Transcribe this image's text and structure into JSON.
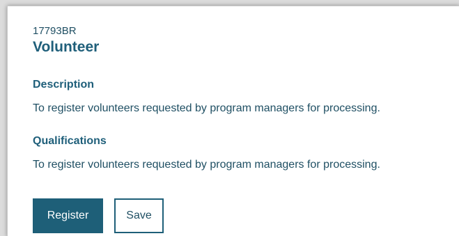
{
  "job": {
    "id": "17793BR",
    "title": "Volunteer"
  },
  "sections": {
    "description": {
      "heading": "Description",
      "text": "To register volunteers requested by program managers for processing."
    },
    "qualifications": {
      "heading": "Qualifications",
      "text": "To register volunteers requested by program managers for processing."
    }
  },
  "actions": {
    "register_label": "Register",
    "save_label": "Save"
  },
  "colors": {
    "accent": "#1e5f78",
    "heading": "#1f5f7a",
    "body_text": "#1f4f63"
  }
}
